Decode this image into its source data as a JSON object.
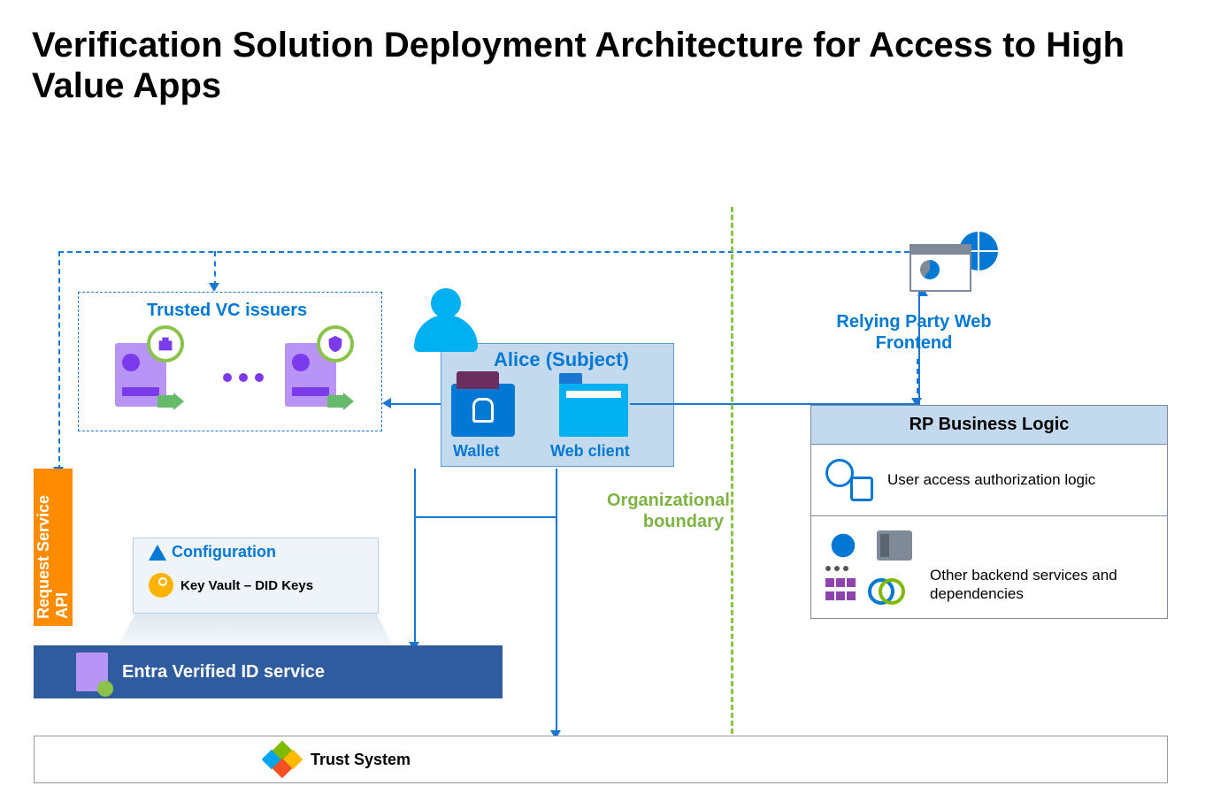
{
  "title": "Verification Solution Deployment Architecture for Access to High Value Apps",
  "issuers": {
    "title": "Trusted VC issuers"
  },
  "api": {
    "label": "Request Service API"
  },
  "alice": {
    "title": "Alice (Subject)",
    "wallet": "Wallet",
    "webclient": "Web client"
  },
  "config": {
    "title": "Configuration",
    "keyvault": "Key Vault – DID Keys"
  },
  "entra": {
    "label": "Entra Verified ID service"
  },
  "trust": {
    "label": "Trust System"
  },
  "boundary": {
    "label": "Organizational boundary"
  },
  "rp_frontend": {
    "label": "Relying Party Web Frontend"
  },
  "rp_logic": {
    "title": "RP Business Logic",
    "auth": "User access authorization logic",
    "backend": "Other backend services and dependencies"
  }
}
